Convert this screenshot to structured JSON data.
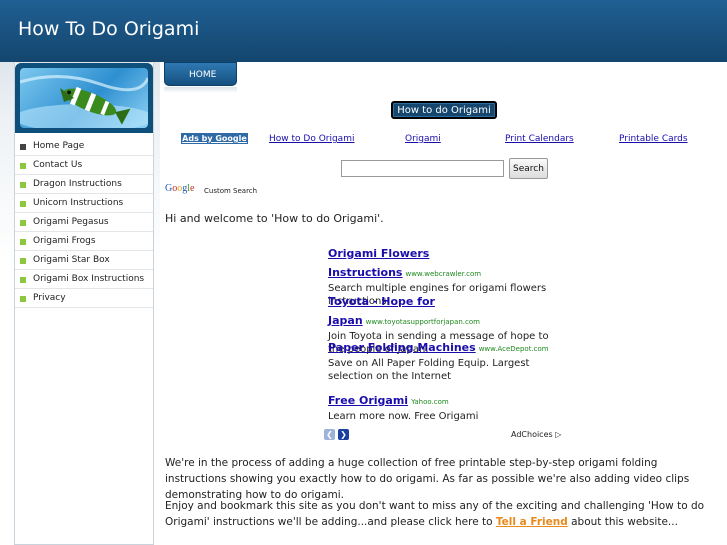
{
  "site": {
    "title": "How To Do Origami"
  },
  "sidebar": {
    "items": [
      {
        "label": "Home Page"
      },
      {
        "label": "Contact Us"
      },
      {
        "label": "Dragon Instructions"
      },
      {
        "label": "Unicorn Instructions"
      },
      {
        "label": "Origami Pegasus"
      },
      {
        "label": "Origami Frogs"
      },
      {
        "label": "Origami Star Box"
      },
      {
        "label": "Origami Box Instructions"
      },
      {
        "label": "Privacy"
      }
    ]
  },
  "nav": {
    "home_tab": "HOME"
  },
  "page_tag": "How to do Origami",
  "ad_links": {
    "label": "Ads by Google",
    "links": [
      "How to Do Origami",
      "Origami",
      "Print Calendars",
      "Printable Cards"
    ]
  },
  "search": {
    "button_label": "Search",
    "value": "",
    "cse_label": "Custom Search"
  },
  "content": {
    "welcome": "Hi and welcome to 'How to do Origami'.",
    "para1": "We're in the process of adding a huge collection of free printable step-by-step origami folding instructions showing you exactly how to do origami.  As far as possible we're also adding video clips demonstrating how to do origami.",
    "para2_before": "Enjoy and bookmark this site as you don't want to miss any of the exciting and challenging 'How to do Origami' instructions we'll be adding...and please click here to ",
    "para2_link": "Tell a Friend",
    "para2_after": " about this website..."
  },
  "ads": [
    {
      "title": "Origami Flowers Instructions",
      "url": "www.webcrawler.com",
      "desc": "Search multiple engines for origami flowers instructions"
    },
    {
      "title": "Toyota - Hope for Japan",
      "url": "www.toyotasupportforjapan.com",
      "desc": "Join Toyota in sending a message of hope to the people of Japan."
    },
    {
      "title": "Paper Folding Machines",
      "url": "www.AceDepot.com",
      "desc": "Save on All Paper Folding Equip. Largest selection on the Internet"
    },
    {
      "title": "Free Origami",
      "url": "Yahoo.com",
      "desc": "Learn more now. Free Origami"
    }
  ],
  "adchoices": "AdChoices"
}
